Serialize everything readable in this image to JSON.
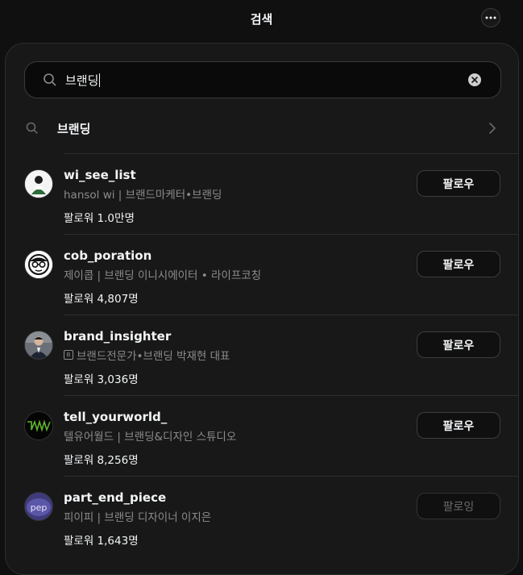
{
  "header": {
    "title": "검색",
    "more_icon": "ellipsis-icon"
  },
  "search": {
    "value": "브랜딩",
    "icon": "search-icon",
    "clear_icon": "clear-icon"
  },
  "suggestion": {
    "label": "브랜딩",
    "icon": "search-icon",
    "chevron": "chevron-right-icon"
  },
  "results": [
    {
      "username": "wi_see_list",
      "bio": "hansol wi | 브랜드마케터•브랜딩",
      "followers": "팔로워 1.0만명",
      "button": "팔로우",
      "avatar_icon": "profile-avatar",
      "has_badge": false
    },
    {
      "username": "cob_poration",
      "bio": "제이콥 | 브랜딩 이니시에이터 • 라이프코칭",
      "followers": "팔로워 4,807명",
      "button": "팔로우",
      "avatar_icon": "profile-avatar",
      "has_badge": false
    },
    {
      "username": "brand_insighter",
      "bio": "브랜드전문가•브랜딩 박재현 대표",
      "followers": "팔로워 3,036명",
      "button": "팔로우",
      "avatar_icon": "profile-avatar",
      "has_badge": true,
      "badge_text": "B"
    },
    {
      "username": "tell_yourworld_",
      "bio": "텔유어월드 | 브랜딩&디자인 스튜디오",
      "followers": "팔로워 8,256명",
      "button": "팔로우",
      "avatar_icon": "profile-avatar",
      "has_badge": false
    },
    {
      "username": "part_end_piece",
      "bio": "피이피 | 브랜딩 디자이너 이지은",
      "followers": "팔로워 1,643명",
      "button": "팔로잉",
      "avatar_icon": "profile-avatar",
      "avatar_text": "pep",
      "has_badge": false
    }
  ],
  "colors": {
    "background": "#101010",
    "panel": "#181818",
    "text": "#f3f5f7",
    "secondary_text": "#8c8c8c"
  }
}
